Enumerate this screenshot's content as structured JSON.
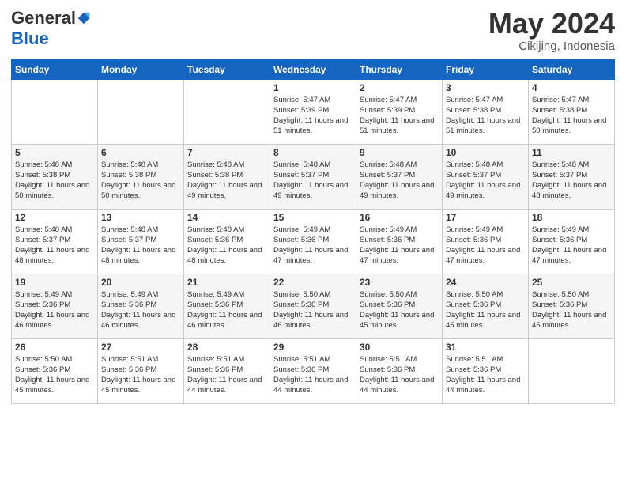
{
  "logo": {
    "general": "General",
    "blue": "Blue"
  },
  "header": {
    "month": "May 2024",
    "location": "Cikijing, Indonesia"
  },
  "weekdays": [
    "Sunday",
    "Monday",
    "Tuesday",
    "Wednesday",
    "Thursday",
    "Friday",
    "Saturday"
  ],
  "weeks": [
    [
      {
        "day": "",
        "sunrise": "",
        "sunset": "",
        "daylight": ""
      },
      {
        "day": "",
        "sunrise": "",
        "sunset": "",
        "daylight": ""
      },
      {
        "day": "",
        "sunrise": "",
        "sunset": "",
        "daylight": ""
      },
      {
        "day": "1",
        "sunrise": "Sunrise: 5:47 AM",
        "sunset": "Sunset: 5:39 PM",
        "daylight": "Daylight: 11 hours and 51 minutes."
      },
      {
        "day": "2",
        "sunrise": "Sunrise: 5:47 AM",
        "sunset": "Sunset: 5:39 PM",
        "daylight": "Daylight: 11 hours and 51 minutes."
      },
      {
        "day": "3",
        "sunrise": "Sunrise: 5:47 AM",
        "sunset": "Sunset: 5:38 PM",
        "daylight": "Daylight: 11 hours and 51 minutes."
      },
      {
        "day": "4",
        "sunrise": "Sunrise: 5:47 AM",
        "sunset": "Sunset: 5:38 PM",
        "daylight": "Daylight: 11 hours and 50 minutes."
      }
    ],
    [
      {
        "day": "5",
        "sunrise": "Sunrise: 5:48 AM",
        "sunset": "Sunset: 5:38 PM",
        "daylight": "Daylight: 11 hours and 50 minutes."
      },
      {
        "day": "6",
        "sunrise": "Sunrise: 5:48 AM",
        "sunset": "Sunset: 5:38 PM",
        "daylight": "Daylight: 11 hours and 50 minutes."
      },
      {
        "day": "7",
        "sunrise": "Sunrise: 5:48 AM",
        "sunset": "Sunset: 5:38 PM",
        "daylight": "Daylight: 11 hours and 49 minutes."
      },
      {
        "day": "8",
        "sunrise": "Sunrise: 5:48 AM",
        "sunset": "Sunset: 5:37 PM",
        "daylight": "Daylight: 11 hours and 49 minutes."
      },
      {
        "day": "9",
        "sunrise": "Sunrise: 5:48 AM",
        "sunset": "Sunset: 5:37 PM",
        "daylight": "Daylight: 11 hours and 49 minutes."
      },
      {
        "day": "10",
        "sunrise": "Sunrise: 5:48 AM",
        "sunset": "Sunset: 5:37 PM",
        "daylight": "Daylight: 11 hours and 49 minutes."
      },
      {
        "day": "11",
        "sunrise": "Sunrise: 5:48 AM",
        "sunset": "Sunset: 5:37 PM",
        "daylight": "Daylight: 11 hours and 48 minutes."
      }
    ],
    [
      {
        "day": "12",
        "sunrise": "Sunrise: 5:48 AM",
        "sunset": "Sunset: 5:37 PM",
        "daylight": "Daylight: 11 hours and 48 minutes."
      },
      {
        "day": "13",
        "sunrise": "Sunrise: 5:48 AM",
        "sunset": "Sunset: 5:37 PM",
        "daylight": "Daylight: 11 hours and 48 minutes."
      },
      {
        "day": "14",
        "sunrise": "Sunrise: 5:48 AM",
        "sunset": "Sunset: 5:36 PM",
        "daylight": "Daylight: 11 hours and 48 minutes."
      },
      {
        "day": "15",
        "sunrise": "Sunrise: 5:49 AM",
        "sunset": "Sunset: 5:36 PM",
        "daylight": "Daylight: 11 hours and 47 minutes."
      },
      {
        "day": "16",
        "sunrise": "Sunrise: 5:49 AM",
        "sunset": "Sunset: 5:36 PM",
        "daylight": "Daylight: 11 hours and 47 minutes."
      },
      {
        "day": "17",
        "sunrise": "Sunrise: 5:49 AM",
        "sunset": "Sunset: 5:36 PM",
        "daylight": "Daylight: 11 hours and 47 minutes."
      },
      {
        "day": "18",
        "sunrise": "Sunrise: 5:49 AM",
        "sunset": "Sunset: 5:36 PM",
        "daylight": "Daylight: 11 hours and 47 minutes."
      }
    ],
    [
      {
        "day": "19",
        "sunrise": "Sunrise: 5:49 AM",
        "sunset": "Sunset: 5:36 PM",
        "daylight": "Daylight: 11 hours and 46 minutes."
      },
      {
        "day": "20",
        "sunrise": "Sunrise: 5:49 AM",
        "sunset": "Sunset: 5:36 PM",
        "daylight": "Daylight: 11 hours and 46 minutes."
      },
      {
        "day": "21",
        "sunrise": "Sunrise: 5:49 AM",
        "sunset": "Sunset: 5:36 PM",
        "daylight": "Daylight: 11 hours and 46 minutes."
      },
      {
        "day": "22",
        "sunrise": "Sunrise: 5:50 AM",
        "sunset": "Sunset: 5:36 PM",
        "daylight": "Daylight: 11 hours and 46 minutes."
      },
      {
        "day": "23",
        "sunrise": "Sunrise: 5:50 AM",
        "sunset": "Sunset: 5:36 PM",
        "daylight": "Daylight: 11 hours and 45 minutes."
      },
      {
        "day": "24",
        "sunrise": "Sunrise: 5:50 AM",
        "sunset": "Sunset: 5:36 PM",
        "daylight": "Daylight: 11 hours and 45 minutes."
      },
      {
        "day": "25",
        "sunrise": "Sunrise: 5:50 AM",
        "sunset": "Sunset: 5:36 PM",
        "daylight": "Daylight: 11 hours and 45 minutes."
      }
    ],
    [
      {
        "day": "26",
        "sunrise": "Sunrise: 5:50 AM",
        "sunset": "Sunset: 5:36 PM",
        "daylight": "Daylight: 11 hours and 45 minutes."
      },
      {
        "day": "27",
        "sunrise": "Sunrise: 5:51 AM",
        "sunset": "Sunset: 5:36 PM",
        "daylight": "Daylight: 11 hours and 45 minutes."
      },
      {
        "day": "28",
        "sunrise": "Sunrise: 5:51 AM",
        "sunset": "Sunset: 5:36 PM",
        "daylight": "Daylight: 11 hours and 44 minutes."
      },
      {
        "day": "29",
        "sunrise": "Sunrise: 5:51 AM",
        "sunset": "Sunset: 5:36 PM",
        "daylight": "Daylight: 11 hours and 44 minutes."
      },
      {
        "day": "30",
        "sunrise": "Sunrise: 5:51 AM",
        "sunset": "Sunset: 5:36 PM",
        "daylight": "Daylight: 11 hours and 44 minutes."
      },
      {
        "day": "31",
        "sunrise": "Sunrise: 5:51 AM",
        "sunset": "Sunset: 5:36 PM",
        "daylight": "Daylight: 11 hours and 44 minutes."
      },
      {
        "day": "",
        "sunrise": "",
        "sunset": "",
        "daylight": ""
      }
    ]
  ]
}
